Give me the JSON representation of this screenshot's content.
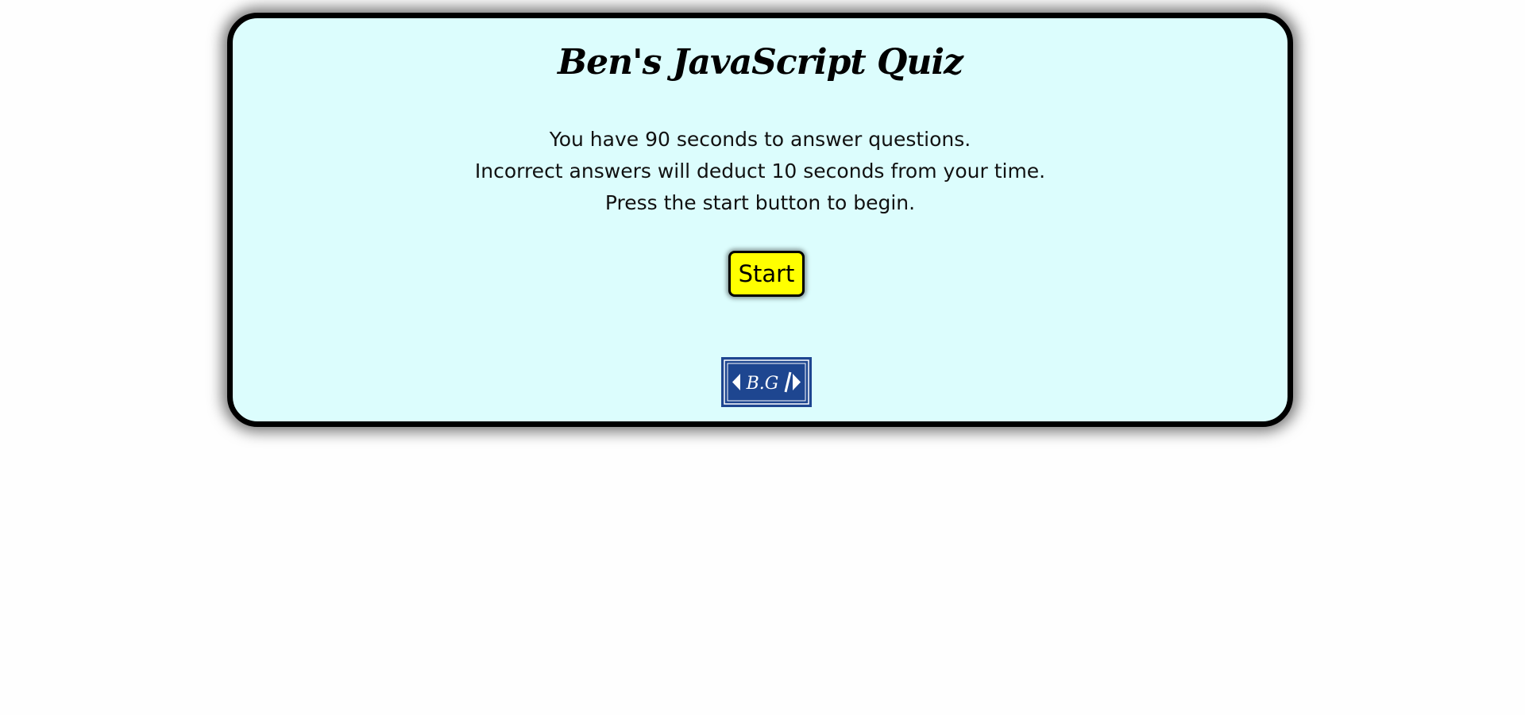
{
  "quiz": {
    "title": "Ben's JavaScript Quiz",
    "instructions": [
      "You have 90 seconds to answer questions.",
      "Incorrect answers will deduct 10 seconds from your time.",
      "Press the start button to begin."
    ],
    "start_label": "Start"
  },
  "logo": {
    "text": "B.G",
    "icon": "code-brackets-logo",
    "color": "#1e4690"
  },
  "colors": {
    "card_background": "#dcfdfd",
    "card_border": "#000000",
    "button_background": "#ffff00",
    "page_background": "#fefefe"
  }
}
